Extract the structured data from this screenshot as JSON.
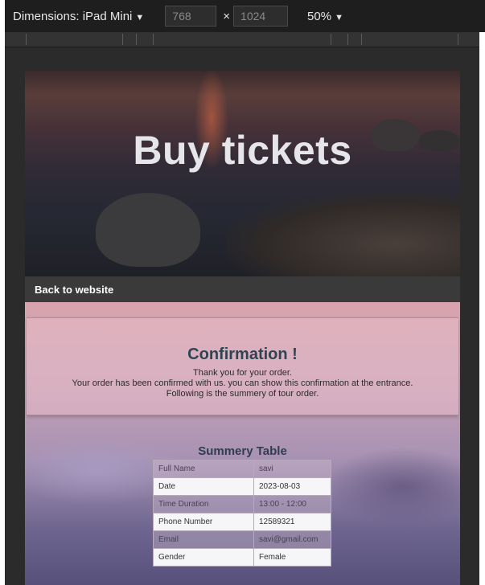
{
  "toolbar": {
    "dimensions_label": "Dimensions: iPad Mini",
    "width_value": "768",
    "height_value": "1024",
    "times_symbol": "×",
    "zoom_label": "50%",
    "caret": "▼"
  },
  "hero": {
    "title": "Buy tickets"
  },
  "nav": {
    "back_link": "Back to website"
  },
  "confirmation": {
    "title": "Confirmation !",
    "line1": "Thank you for your order.",
    "line2": "Your order has been confirmed with us. you can show this confirmation at the entrance.",
    "line3": "Following is the summery of tour order."
  },
  "summary": {
    "title": "Summery Table",
    "rows": [
      {
        "label": "Full Name",
        "value": "savi"
      },
      {
        "label": "Date",
        "value": "2023-08-03"
      },
      {
        "label": "Time Duration",
        "value": "13:00 - 12:00"
      },
      {
        "label": "Phone Number",
        "value": "12589321"
      },
      {
        "label": "Email",
        "value": "savi@gmail.com"
      },
      {
        "label": "Gender",
        "value": "Female"
      }
    ]
  },
  "colors": {
    "toolbar_bg": "#1e1e1e",
    "heading": "#2e4452",
    "back_bar": "#3a3a3a"
  }
}
